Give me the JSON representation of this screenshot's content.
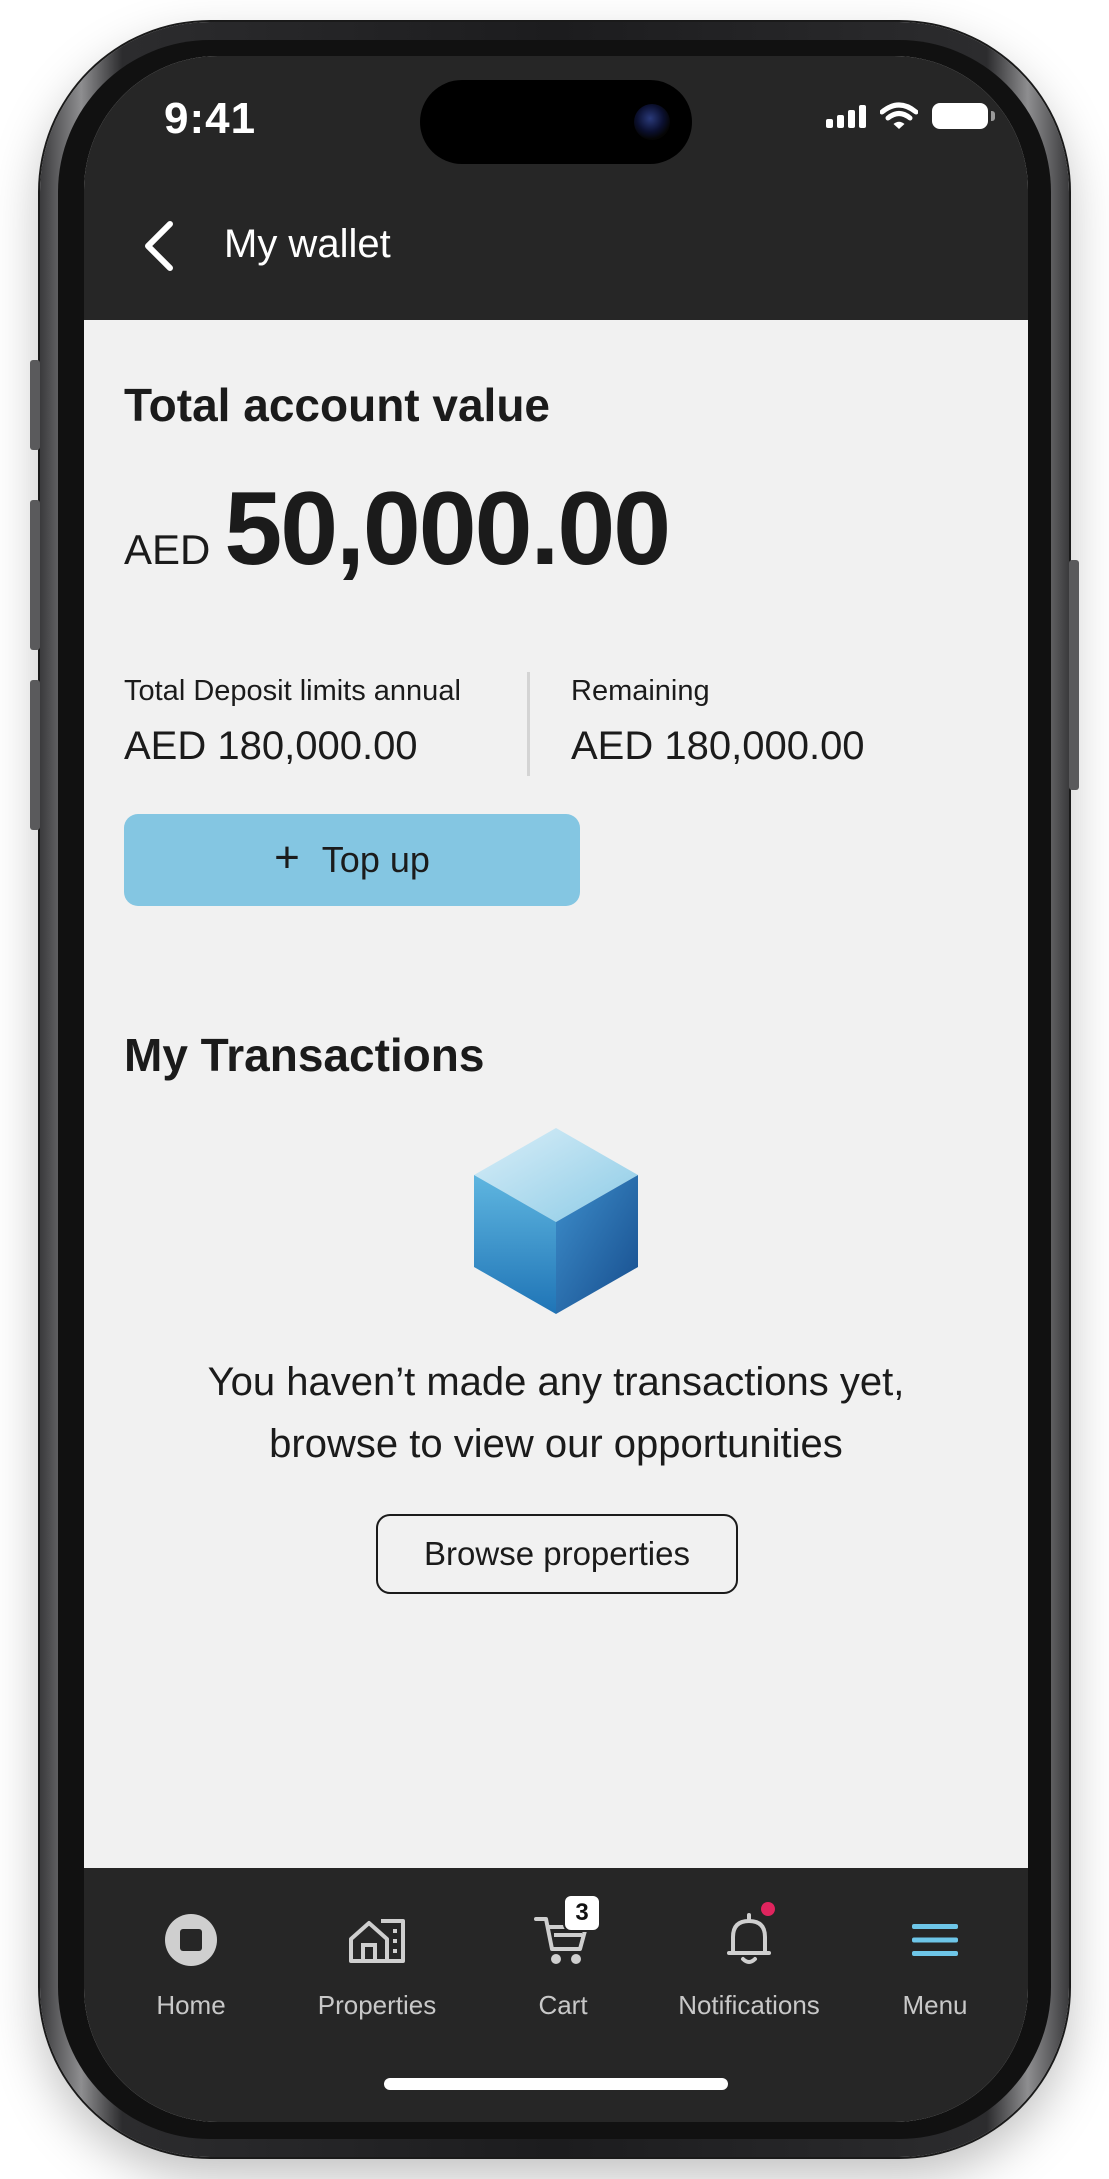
{
  "status_bar": {
    "time": "9:41",
    "signal_icon": "signal-bars-icon",
    "wifi_icon": "wifi-icon",
    "battery_icon": "battery-icon"
  },
  "header": {
    "back_icon": "chevron-left-icon",
    "title": "My wallet"
  },
  "wallet": {
    "title": "Total account value",
    "currency": "AED",
    "amount": "50,000.00",
    "deposit_limit_label": "Total Deposit limits annual",
    "deposit_limit_value": "AED 180,000.00",
    "remaining_label": "Remaining",
    "remaining_value": "AED 180,000.00",
    "topup_icon": "plus-icon",
    "topup_label": "Top up"
  },
  "transactions": {
    "title": "My Transactions",
    "empty_illustration": "cube-icon",
    "empty_line1": "You haven’t made any transactions yet,",
    "empty_line2": "browse to view our opportunities",
    "browse_label": "Browse properties"
  },
  "tabbar": {
    "items": [
      {
        "label": "Home",
        "icon": "home-icon"
      },
      {
        "label": "Properties",
        "icon": "properties-icon"
      },
      {
        "label": "Cart",
        "icon": "cart-icon",
        "badge": "3"
      },
      {
        "label": "Notifications",
        "icon": "bell-icon",
        "has_dot": true
      },
      {
        "label": "Menu",
        "icon": "menu-icon",
        "active": true
      }
    ]
  },
  "colors": {
    "header_bg": "#262626",
    "screen_bg": "#f1f1f1",
    "accent": "#84c6e2",
    "notification_dot": "#e0245e",
    "menu_active": "#6ec6e8"
  }
}
